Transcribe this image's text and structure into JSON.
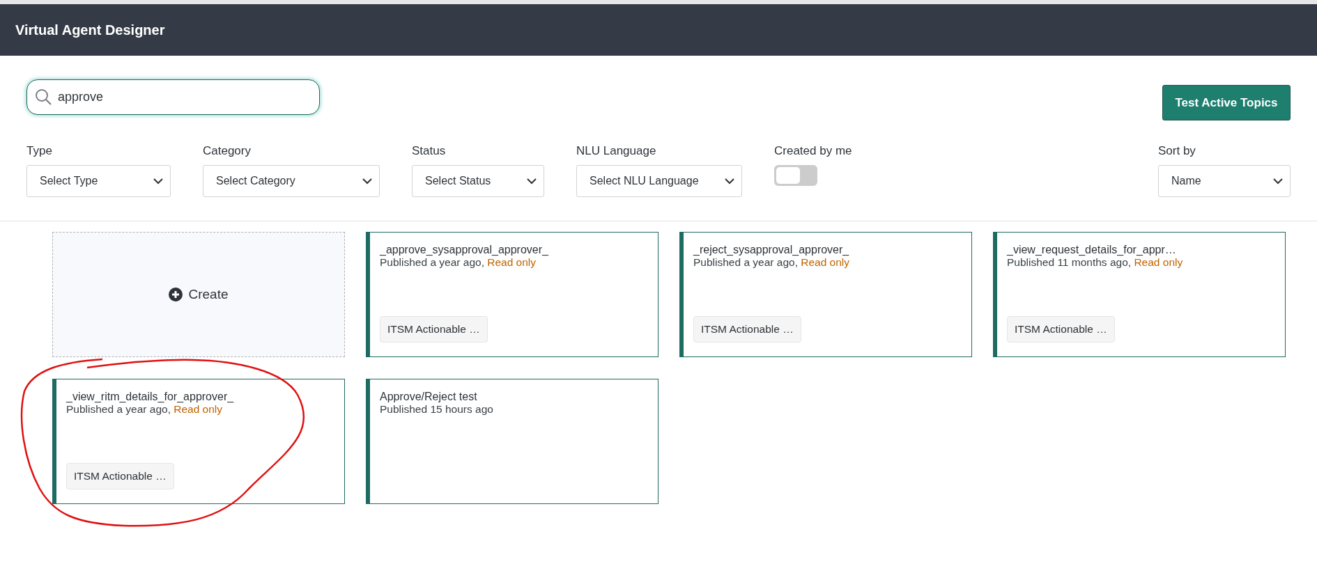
{
  "header": {
    "title": "Virtual Agent Designer"
  },
  "search": {
    "value": "approve"
  },
  "test_button": "Test Active Topics",
  "filters": [
    {
      "kind": "select",
      "label": "Type",
      "value": "Select Type"
    },
    {
      "kind": "select",
      "label": "Category",
      "value": "Select Category"
    },
    {
      "kind": "select",
      "label": "Status",
      "value": "Select Status"
    },
    {
      "kind": "select",
      "label": "NLU Language",
      "value": "Select NLU Language"
    },
    {
      "kind": "toggle",
      "label": "Created by me",
      "on": false
    }
  ],
  "sort": {
    "label": "Sort by",
    "value": "Name"
  },
  "create_label": "Create",
  "topics": [
    {
      "title": "_approve_sysapproval_approver_",
      "status": "Published",
      "age": "a year ago,",
      "note": "Read only",
      "tag": "ITSM Actionable …",
      "circled": false
    },
    {
      "title": "_reject_sysapproval_approver_",
      "status": "Published",
      "age": "a year ago,",
      "note": "Read only",
      "tag": "ITSM Actionable …",
      "circled": false
    },
    {
      "title": "_view_request_details_for_appr…",
      "status": "Published",
      "age": "11 months ago,",
      "note": "Read only",
      "tag": "ITSM Actionable …",
      "circled": false
    },
    {
      "title": "_view_ritm_details_for_approver_",
      "status": "Published",
      "age": "a year ago,",
      "note": "Read only",
      "tag": "ITSM Actionable …",
      "circled": true
    },
    {
      "title": "Approve/Reject test",
      "status": "Published",
      "age": "15 hours ago",
      "circled": false
    }
  ]
}
